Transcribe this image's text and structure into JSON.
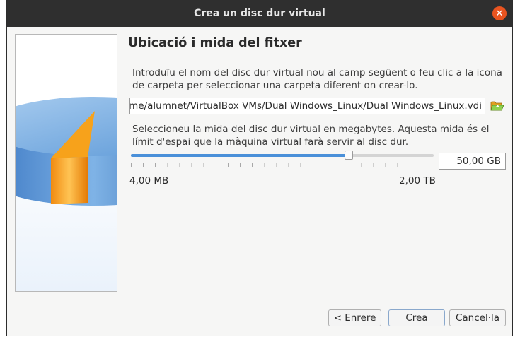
{
  "window": {
    "title": "Crea un disc dur virtual"
  },
  "page": {
    "heading": "Ubicació i mida del fitxer",
    "location_description": "Introduïu el nom del disc dur virtual nou al camp següent o feu clic a la icona de carpeta per seleccionar una carpeta diferent on crear-lo.",
    "file_path": "/home/alumnet/VirtualBox VMs/Dual Windows_Linux/Dual Windows_Linux.vdi",
    "size_description": "Seleccioneu la mida del disc dur virtual en megabytes. Aquesta mida és el límit d'espai que la màquina virtual farà servir al disc dur.",
    "size_value": "50,00 GB",
    "slider_fraction": 0.72,
    "min_label": "4,00 MB",
    "max_label": "2,00 TB"
  },
  "buttons": {
    "back_prefix": "< ",
    "back_mnemonic": "E",
    "back_rest": "nrere",
    "create": "Crea",
    "cancel": "Cancel·la"
  },
  "colors": {
    "title_bar": "#2f2f2f",
    "close_button": "#e95420",
    "slider_fill": "#4a90d9",
    "disk_orange": "#f7a21b",
    "disk_blue": "#5b9ad6"
  },
  "icons": {
    "close": "close-icon",
    "folder": "folder-open-icon",
    "side": "hard-disk-illustration"
  }
}
